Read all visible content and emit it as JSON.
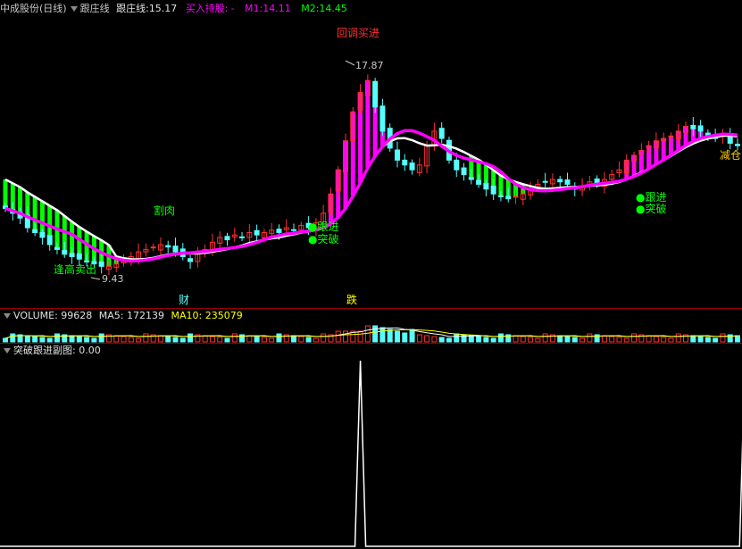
{
  "header": {
    "stock": "中成股份(日线)",
    "indicator": "跟庄线",
    "line_label": "跟庄线:",
    "line_value": "15.17",
    "signal_label": "买入持股:",
    "signal_value": "-",
    "m1_label": "M1:",
    "m1_value": "14.11",
    "m2_label": "M2:",
    "m2_value": "14.45"
  },
  "annotations": {
    "pullback_buy": "回调买进",
    "cut_loss": "割肉",
    "high_sell": "逢高卖出",
    "follow1": "●跟进",
    "breakout1": "●突破",
    "follow2": "●跟进",
    "breakout2": "●突破",
    "reduce": "减仓",
    "fin_marker": "财",
    "drop_marker": "跌",
    "high_price": "17.87",
    "low_price": "9.43"
  },
  "volume_header": {
    "title": "VOLUME:",
    "value": "99628",
    "ma5_label": "MA5:",
    "ma5_value": "172139",
    "ma10_label": "MA10:",
    "ma10_value": "235079"
  },
  "sub_header": {
    "title": "突破跟进副图",
    "value": ": 0.00"
  },
  "colors": {
    "up": "#ff3030",
    "down": "#54ffff",
    "white_line": "#ffffff",
    "magenta": "#ff00ff",
    "green_fill": "#00ff00"
  },
  "chart_data": {
    "type": "line",
    "closes": [
      12.0,
      11.8,
      11.6,
      11.2,
      11.0,
      10.8,
      10.5,
      10.3,
      10.1,
      10.0,
      9.9,
      9.8,
      9.7,
      9.6,
      9.6,
      9.7,
      9.8,
      10.0,
      10.2,
      10.3,
      10.4,
      10.5,
      10.4,
      10.2,
      10.0,
      9.8,
      10.1,
      10.3,
      10.6,
      10.8,
      10.7,
      10.9,
      10.8,
      11.0,
      10.9,
      11.0,
      11.1,
      11.0,
      11.2,
      11.1,
      11.3,
      11.2,
      11.4,
      11.8,
      12.6,
      13.6,
      14.8,
      16.0,
      16.8,
      17.3,
      16.2,
      15.2,
      14.5,
      14.0,
      13.8,
      13.6,
      13.8,
      14.6,
      15.2,
      14.9,
      14.0,
      13.6,
      13.4,
      13.2,
      13.0,
      12.8,
      12.6,
      12.5,
      12.4,
      12.5,
      12.6,
      12.8,
      13.0,
      13.1,
      13.2,
      13.1,
      13.0,
      12.8,
      12.9,
      13.1,
      13.0,
      13.2,
      13.4,
      13.6,
      14.0,
      14.2,
      14.4,
      14.6,
      14.8,
      14.9,
      15.0,
      15.2,
      15.4,
      15.3,
      15.2,
      15.0,
      14.9,
      15.1,
      14.7,
      14.6
    ],
    "high": 17.87,
    "low": 9.43,
    "volume_peaks": [
      48,
      100
    ],
    "subchart_max": 1,
    "subchart_value": 0.0
  }
}
